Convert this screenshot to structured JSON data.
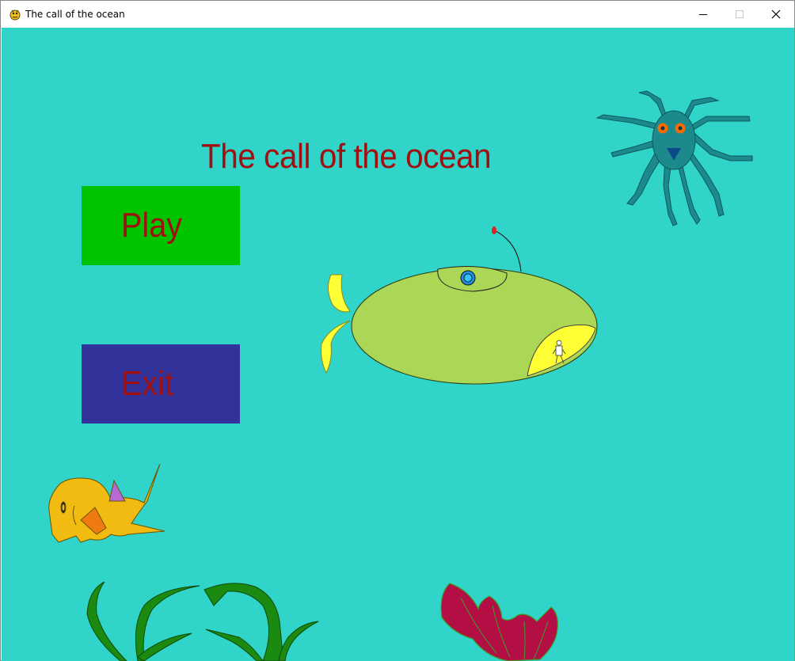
{
  "window": {
    "title": "The call of the ocean",
    "icon": "pygame-snake-icon",
    "controls": [
      "minimize-icon",
      "maximize-icon",
      "close-icon"
    ]
  },
  "menu": {
    "title": "The call of the ocean",
    "play_label": "Play",
    "exit_label": "Exit"
  },
  "colors": {
    "background": "#31d4c8",
    "title_text": "#a01010",
    "play_button": "#00c400",
    "exit_button": "#31339a",
    "submarine": "#acd655"
  },
  "sprites": [
    "submarine",
    "octopus",
    "fish",
    "seaweed-left",
    "seaweed-middle",
    "red-coral"
  ]
}
